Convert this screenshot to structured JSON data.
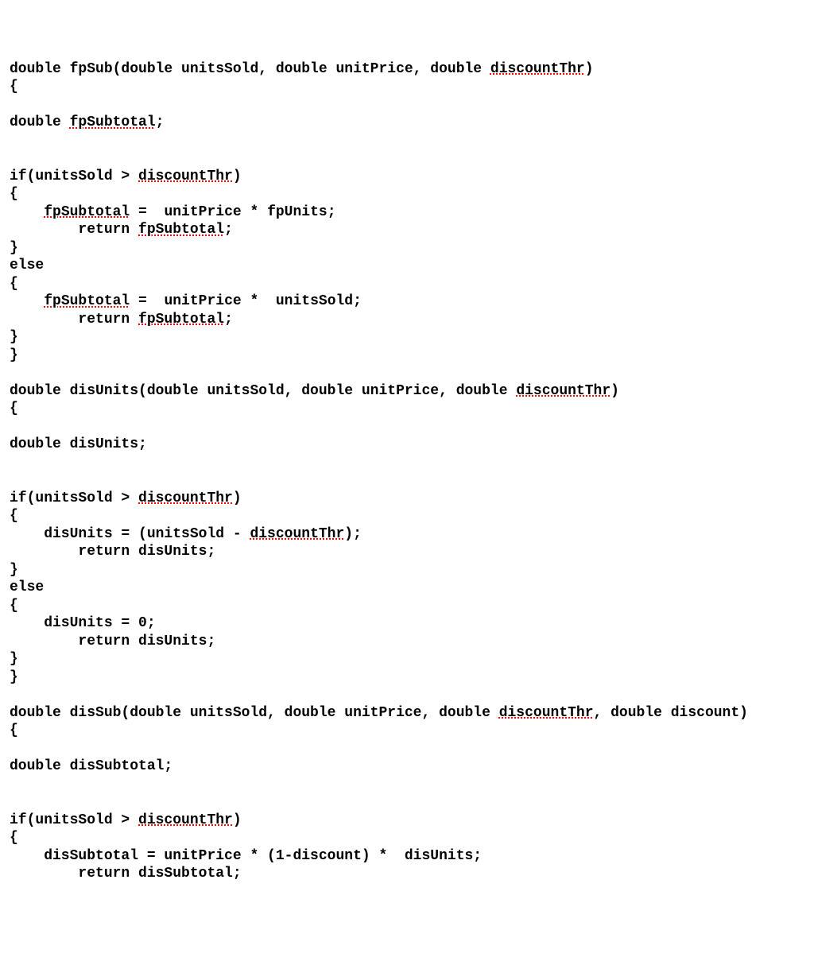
{
  "code": {
    "lines": [
      {
        "segments": [
          {
            "t": "double fpSub(double unitsSold, double unitPrice, double "
          },
          {
            "t": "discountThr",
            "e": true
          },
          {
            "t": ")"
          }
        ]
      },
      {
        "segments": [
          {
            "t": "{"
          }
        ]
      },
      {
        "segments": [
          {
            "t": ""
          }
        ]
      },
      {
        "segments": [
          {
            "t": "double "
          },
          {
            "t": "fpSubtotal",
            "e": true
          },
          {
            "t": ";"
          }
        ]
      },
      {
        "segments": [
          {
            "t": ""
          }
        ]
      },
      {
        "segments": [
          {
            "t": ""
          }
        ]
      },
      {
        "segments": [
          {
            "t": "if(unitsSold > "
          },
          {
            "t": "discountThr",
            "e": true
          },
          {
            "t": ")"
          }
        ]
      },
      {
        "segments": [
          {
            "t": "{"
          }
        ]
      },
      {
        "segments": [
          {
            "t": "    "
          },
          {
            "t": "fpSubtotal",
            "e": true
          },
          {
            "t": " =  unitPrice * fpUnits;"
          }
        ]
      },
      {
        "segments": [
          {
            "t": "        return "
          },
          {
            "t": "fpSubtotal",
            "e": true
          },
          {
            "t": ";"
          }
        ]
      },
      {
        "segments": [
          {
            "t": "}"
          }
        ]
      },
      {
        "segments": [
          {
            "t": "else"
          }
        ]
      },
      {
        "segments": [
          {
            "t": "{"
          }
        ]
      },
      {
        "segments": [
          {
            "t": "    "
          },
          {
            "t": "fpSubtotal",
            "e": true
          },
          {
            "t": " =  unitPrice *  unitsSold;"
          }
        ]
      },
      {
        "segments": [
          {
            "t": "        return "
          },
          {
            "t": "fpSubtotal",
            "e": true
          },
          {
            "t": ";"
          }
        ]
      },
      {
        "segments": [
          {
            "t": "}"
          }
        ]
      },
      {
        "segments": [
          {
            "t": "}"
          }
        ]
      },
      {
        "segments": [
          {
            "t": ""
          }
        ]
      },
      {
        "segments": [
          {
            "t": "double disUnits(double unitsSold, double unitPrice, double "
          },
          {
            "t": "discountThr",
            "e": true
          },
          {
            "t": ")"
          }
        ]
      },
      {
        "segments": [
          {
            "t": "{"
          }
        ]
      },
      {
        "segments": [
          {
            "t": ""
          }
        ]
      },
      {
        "segments": [
          {
            "t": "double disUnits;"
          }
        ]
      },
      {
        "segments": [
          {
            "t": ""
          }
        ]
      },
      {
        "segments": [
          {
            "t": ""
          }
        ]
      },
      {
        "segments": [
          {
            "t": "if(unitsSold > "
          },
          {
            "t": "discountThr",
            "e": true
          },
          {
            "t": ")"
          }
        ]
      },
      {
        "segments": [
          {
            "t": "{"
          }
        ]
      },
      {
        "segments": [
          {
            "t": "    disUnits = (unitsSold - "
          },
          {
            "t": "discountThr",
            "e": true
          },
          {
            "t": ");"
          }
        ]
      },
      {
        "segments": [
          {
            "t": "        return disUnits;"
          }
        ]
      },
      {
        "segments": [
          {
            "t": "}"
          }
        ]
      },
      {
        "segments": [
          {
            "t": "else"
          }
        ]
      },
      {
        "segments": [
          {
            "t": "{"
          }
        ]
      },
      {
        "segments": [
          {
            "t": "    disUnits = 0;"
          }
        ]
      },
      {
        "segments": [
          {
            "t": "        return disUnits;"
          }
        ]
      },
      {
        "segments": [
          {
            "t": "}"
          }
        ]
      },
      {
        "segments": [
          {
            "t": "}"
          }
        ]
      },
      {
        "segments": [
          {
            "t": ""
          }
        ]
      },
      {
        "segments": [
          {
            "t": "double disSub(double unitsSold, double unitPrice, double "
          },
          {
            "t": "discountThr",
            "e": true
          },
          {
            "t": ", double discount)"
          }
        ]
      },
      {
        "segments": [
          {
            "t": "{"
          }
        ]
      },
      {
        "segments": [
          {
            "t": ""
          }
        ]
      },
      {
        "segments": [
          {
            "t": "double disSubtotal;"
          }
        ]
      },
      {
        "segments": [
          {
            "t": ""
          }
        ]
      },
      {
        "segments": [
          {
            "t": ""
          }
        ]
      },
      {
        "segments": [
          {
            "t": "if(unitsSold > "
          },
          {
            "t": "discountThr",
            "e": true
          },
          {
            "t": ")"
          }
        ]
      },
      {
        "segments": [
          {
            "t": "{"
          }
        ]
      },
      {
        "segments": [
          {
            "t": "    disSubtotal = unitPrice * (1-discount) *  disUnits;"
          }
        ]
      },
      {
        "segments": [
          {
            "t": "        return disSubtotal;"
          }
        ]
      }
    ]
  }
}
